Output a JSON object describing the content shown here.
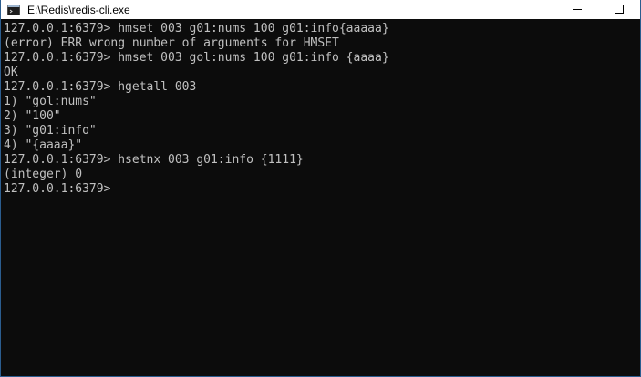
{
  "window": {
    "title": "E:\\Redis\\redis-cli.exe"
  },
  "icons": {
    "app": "console-window-icon",
    "minimize": "minimize-icon",
    "maximize": "maximize-icon"
  },
  "colors": {
    "console_bg": "#0c0c0c",
    "console_text": "#c0c0c0",
    "titlebar_bg": "#ffffff",
    "border": "#2b5d8f"
  },
  "console": {
    "lines": [
      "127.0.0.1:6379> hmset 003 g01:nums 100 g01:info{aaaaa}",
      "(error) ERR wrong number of arguments for HMSET",
      "127.0.0.1:6379> hmset 003 gol:nums 100 g01:info {aaaa}",
      "OK",
      "127.0.0.1:6379> hgetall 003",
      "1) \"gol:nums\"",
      "2) \"100\"",
      "3) \"g01:info\"",
      "4) \"{aaaa}\"",
      "127.0.0.1:6379> hsetnx 003 g01:info {1111}",
      "(integer) 0",
      "127.0.0.1:6379>"
    ]
  }
}
